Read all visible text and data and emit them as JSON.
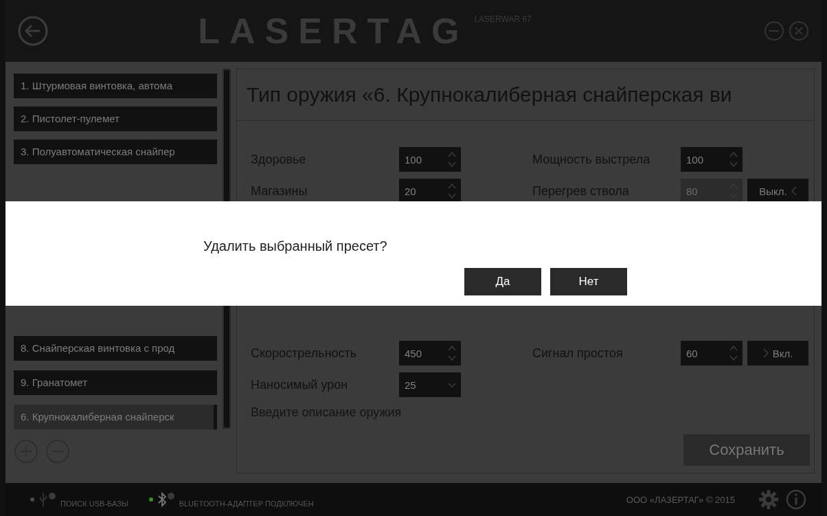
{
  "header": {
    "logo": "LASERTAG",
    "logo_sub": "LASERWAR 67"
  },
  "sidebar": {
    "items_top": [
      {
        "label": "1. Штурмовая винтовка, автома",
        "selected": false
      },
      {
        "label": "2. Пистолет-пулемет",
        "selected": false
      },
      {
        "label": "3. Полуавтоматическая снайпер",
        "selected": false
      }
    ],
    "items_bottom": [
      {
        "label": "8. Снайперская винтовка с прод",
        "selected": false
      },
      {
        "label": "9. Гранатомет",
        "selected": false
      },
      {
        "label": "6. Крупнокалиберная снайперск",
        "selected": true
      }
    ]
  },
  "panel": {
    "title": "Тип оружия «6. Крупнокалиберная снайперская ви",
    "fields_top": {
      "left": [
        {
          "label": "Здоровье",
          "value": "100",
          "kind": "spinner",
          "disabled": false
        },
        {
          "label": "Магазины",
          "value": "20",
          "kind": "spinner",
          "disabled": false
        }
      ],
      "right": [
        {
          "label": "Мощность выстрела",
          "value": "100",
          "kind": "spinner",
          "disabled": false
        },
        {
          "label": "Перегрев ствола",
          "value": "80",
          "kind": "spinner",
          "disabled": true,
          "toggle": {
            "label": "Выкл.",
            "on": false
          }
        }
      ]
    },
    "fields_bottom": {
      "left": [
        {
          "label": "Скорострельность",
          "value": "450",
          "kind": "spinner",
          "disabled": false
        },
        {
          "label": "Наносимый урон",
          "value": "25",
          "kind": "dropdown",
          "disabled": false
        }
      ],
      "right": [
        {
          "label": "Сигнал простоя",
          "value": "60",
          "kind": "spinner",
          "disabled": false,
          "toggle": {
            "label": "Вкл.",
            "on": true
          }
        }
      ]
    },
    "description": {
      "placeholder": "Введите описание оружия"
    },
    "save_button": "Сохранить"
  },
  "dialog": {
    "message": "Удалить выбранный пресет?",
    "buttons": [
      "Да",
      "Нет"
    ]
  },
  "status_bar": {
    "items": [
      {
        "kind": "usb",
        "label": "ПОИСК USB-БАЗЫ",
        "color": "#4a4a4a"
      },
      {
        "kind": "bluetooth",
        "label": "BLUETOOTH-АДАПТЕР ПОДКЛЮЧЕН",
        "color": "#3f8a2a"
      }
    ],
    "copyright": "ООО «ЛАЗЕРТАГ» © 2015"
  }
}
